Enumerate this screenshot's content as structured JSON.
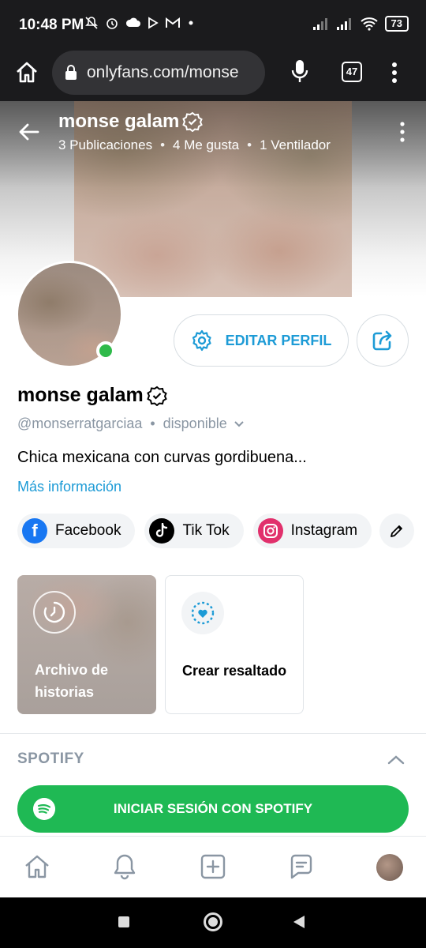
{
  "status_bar": {
    "time": "10:48 PM",
    "left_icons": [
      "mute-icon",
      "alarm-icon",
      "cloud-icon",
      "play-icon",
      "gmail-icon",
      "dot-icon"
    ],
    "battery": "73"
  },
  "browser": {
    "url": "onlyfans.com/monse",
    "tab_count": "47"
  },
  "header": {
    "name": "monse galam",
    "publications": "3 Publicaciones",
    "likes": "4 Me gusta",
    "fans": "1 Ventilador",
    "separator": "•"
  },
  "profile": {
    "name": "monse galam",
    "handle": "@monserratgarciaa",
    "status": "disponible",
    "separator": "•",
    "bio": "Chica mexicana con curvas gordibuena...",
    "more_info": "Más información",
    "edit_button": "EDITAR PERFIL"
  },
  "social_links": [
    {
      "label": "Facebook",
      "icon": "facebook-icon",
      "color": "#1877f2"
    },
    {
      "label": "Tik Tok",
      "icon": "tiktok-icon",
      "color": "#000000"
    },
    {
      "label": "Instagram",
      "icon": "instagram-icon",
      "color": "#e1306c"
    }
  ],
  "highlights": {
    "archive_label": "Archivo de historias",
    "create_label": "Crear resaltado"
  },
  "spotify": {
    "title": "SPOTIFY",
    "button": "INICIAR SESIÓN CON SPOTIFY",
    "color": "#1fb954"
  },
  "colors": {
    "accent": "#1d9bd6",
    "online": "#2fba4a",
    "muted_text": "#8a96a3"
  }
}
